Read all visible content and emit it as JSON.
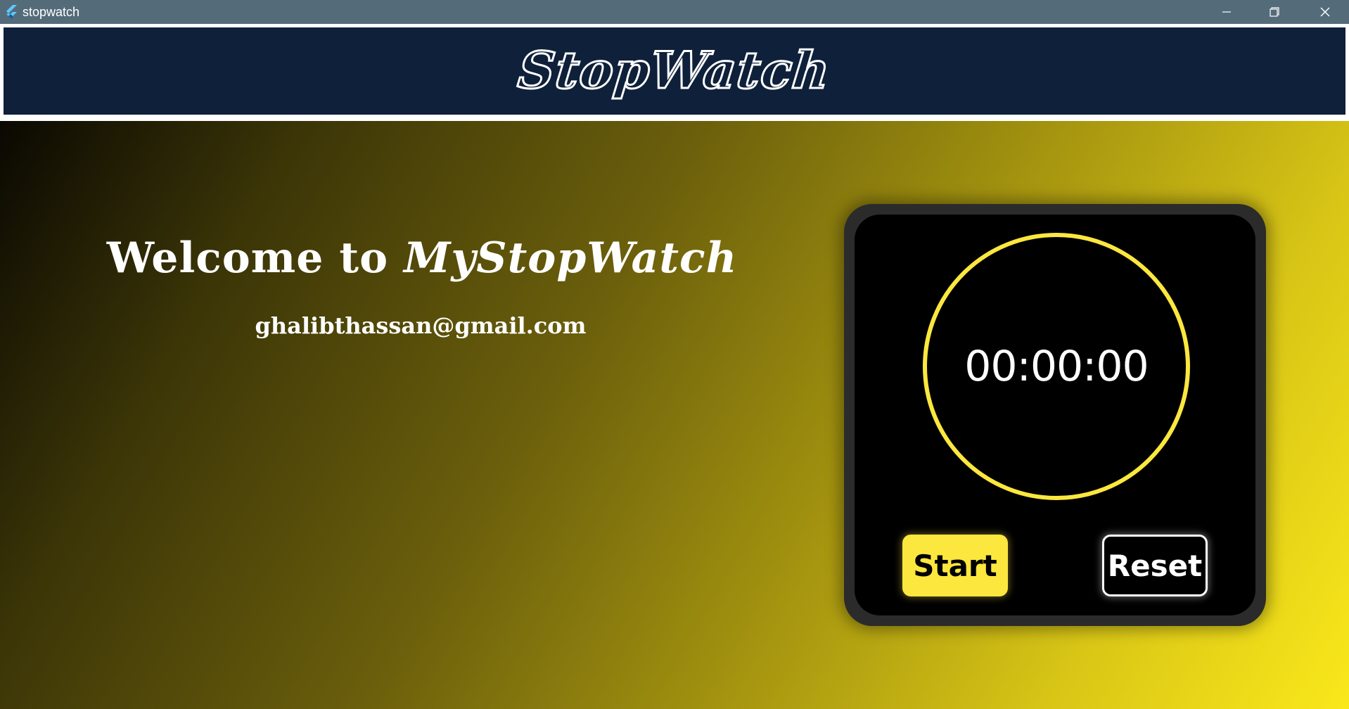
{
  "window": {
    "title": "stopwatch"
  },
  "header": {
    "title": "StopWatch"
  },
  "main": {
    "welcome_prefix": "Welcome to ",
    "welcome_brand": "MyStopWatch",
    "email": "ghalibthassan@gmail.com"
  },
  "stopwatch": {
    "time": "00:00:00",
    "start_label": "Start",
    "reset_label": "Reset"
  },
  "icons": {
    "app": "flutter-logo-icon",
    "minimize": "minimize-icon",
    "restore": "restore-icon",
    "close": "close-icon"
  },
  "colors": {
    "titlebar": "#546b7a",
    "header_bg": "#0f203a",
    "accent_yellow": "#fce73e",
    "card_bg": "#2b2b2b"
  }
}
